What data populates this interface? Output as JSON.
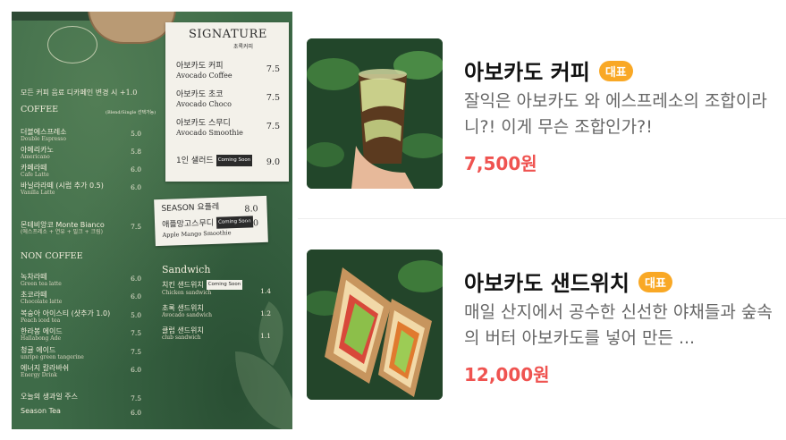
{
  "menu_board": {
    "season_note": "모든 커피 음료 디카페인 변경 시 +1.0",
    "coffee_title": "COFFEE",
    "coffee_sub": "(Blend/Single 선택가능)",
    "coffee_items": [
      {
        "ko": "더블에스프레소",
        "en": "Double Espresso",
        "price": "5.0"
      },
      {
        "ko": "아메리카노",
        "en": "Americano",
        "price": "5.8"
      },
      {
        "ko": "카페라떼",
        "en": "Cafe Latte",
        "price": "6.0"
      },
      {
        "ko": "바닐라라떼 (시럽 추가 0.5)",
        "en": "Vanilla Latte",
        "price": "6.0"
      },
      {
        "ko": "몬테비앙코 Monte Bianco",
        "en": "(에스프레소 + 연유 + 밀크 + 크림)",
        "price": "7.5"
      }
    ],
    "noncoffee_title": "NON COFFEE",
    "noncoffee_items": [
      {
        "ko": "녹차라떼",
        "en": "Green tea latte",
        "price": "6.0"
      },
      {
        "ko": "초코라떼",
        "en": "Chocolate latte",
        "price": "6.0"
      },
      {
        "ko": "복숭아 아이스티 (샷추가 1.0)",
        "en": "Peach iced tea",
        "price": "5.0"
      },
      {
        "ko": "한라봉 에이드",
        "en": "Hallabong Ade",
        "price": "7.5"
      },
      {
        "ko": "청귤 에이드",
        "en": "unripe green tangerine",
        "price": "7.5"
      },
      {
        "ko": "에너지 칼라바쉬",
        "en": "Energy Drink",
        "price": "6.0"
      },
      {
        "ko": "오늘의 생과일 주스",
        "en": "",
        "price": "7.5"
      },
      {
        "ko": "Season Tea",
        "en": "",
        "price": "6.0"
      }
    ],
    "signature": {
      "title": "SIGNATURE",
      "subtitle": "초록커피",
      "items": [
        {
          "ko": "아보카도 커피",
          "en": "Avocado Coffee",
          "price": "7.5"
        },
        {
          "ko": "아보카도 초코",
          "en": "Avocado Choco",
          "price": "7.5"
        },
        {
          "ko": "아보카도 스무디",
          "en": "Avocado Smoothie",
          "price": "7.5"
        },
        {
          "ko": "1인 샐러드",
          "en": "",
          "price": "9.0",
          "soon": "Coming Soon"
        }
      ]
    },
    "season": {
      "items": [
        {
          "ko": "SEASON 요플레",
          "en": "",
          "price": "8.0"
        },
        {
          "ko": "애플망고스무디",
          "en": "Apple Mango Smoothie",
          "price": "8.0",
          "soon": "Coming Soon"
        }
      ]
    },
    "sandwich": {
      "title": "Sandwich",
      "items": [
        {
          "ko": "치킨 샌드위치",
          "en": "Chicken sandwich",
          "price": "1.4",
          "soon": "Coming Soon"
        },
        {
          "ko": "초록 샌드위치",
          "en": "Avocado sandwich",
          "price": "1.2"
        },
        {
          "ko": "클럽 샌드위치",
          "en": "club sandwich",
          "price": "1.1"
        }
      ]
    }
  },
  "products": [
    {
      "name": "아보카도 커피",
      "badge": "대표",
      "description": "잘익은 아보카도 와 에스프레소의 조합이라니?! 이게 무슨 조합인가?!",
      "price": "7,500원",
      "image_icon": "avocado-coffee-photo"
    },
    {
      "name": "아보카도 샌드위치",
      "badge": "대표",
      "description": "매일 산지에서 공수한 신선한 야채들과 숲속의 버터 아보카도를 넣어 만든 ...",
      "price": "12,000원",
      "image_icon": "avocado-sandwich-photo"
    }
  ],
  "colors": {
    "badge": "#f9a825",
    "price": "#ef5350",
    "board_green": "#3e6b48"
  }
}
